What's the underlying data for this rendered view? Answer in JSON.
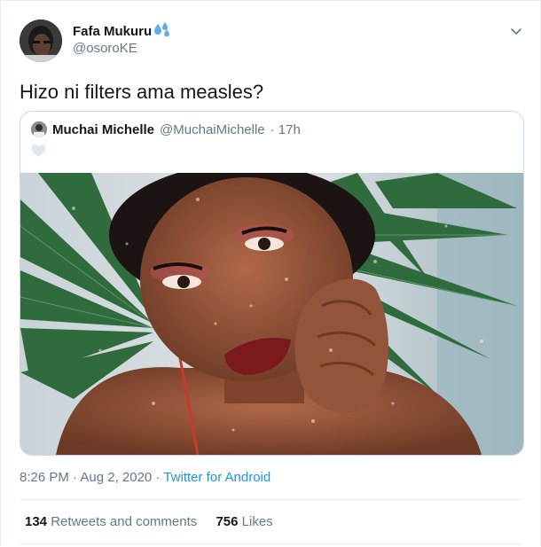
{
  "tweet": {
    "author_name": "Fafa Mukuru",
    "author_handle": "@osoroKE",
    "text": "Hizo ni filters ama measles?",
    "timestamp": "8:26 PM · Aug 2, 2020",
    "separator": " · ",
    "source": "Twitter for Android",
    "retweets_count": "134",
    "retweets_label": "Retweets and comments",
    "likes_count": "756",
    "likes_label": "Likes"
  },
  "quoted_tweet": {
    "author_name": "Muchai Michelle",
    "author_handle": "@MuchaiMichelle",
    "age": "· 17h"
  },
  "colors": {
    "text_primary": "#14171a",
    "text_secondary": "#657786",
    "link": "#1b95e0",
    "border": "#ccd6dd"
  },
  "icons": {
    "emoji": "sweat-droplets-icon",
    "menu": "chevron-down-icon",
    "heart": "heart-icon"
  }
}
